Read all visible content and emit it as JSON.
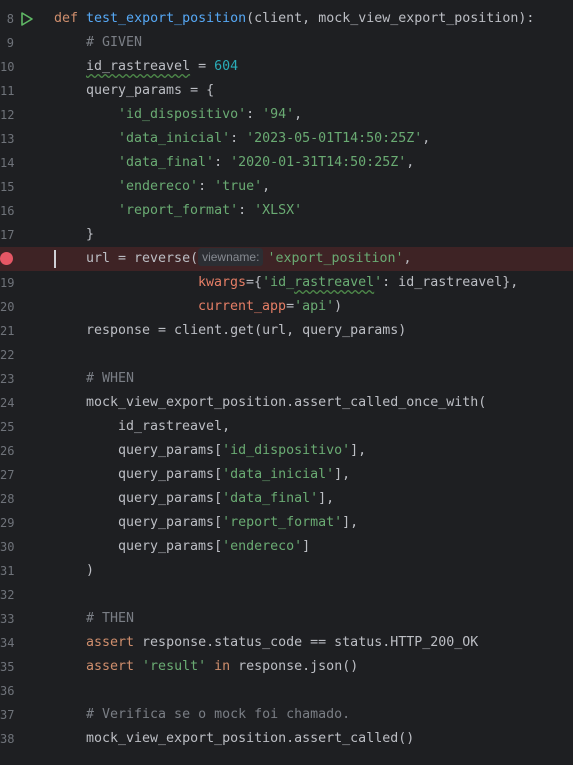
{
  "lines": [
    {
      "num": "8",
      "indent": 0,
      "tokens": [
        {
          "t": "def ",
          "c": "kw"
        },
        {
          "t": "test_export_position",
          "c": "fn"
        },
        {
          "t": "(client, mock_view_export_position):",
          "c": ""
        }
      ]
    },
    {
      "num": "9",
      "indent": 1,
      "tokens": [
        {
          "t": "# GIVEN",
          "c": "cm"
        }
      ]
    },
    {
      "num": "10",
      "indent": 1,
      "tokens": [
        {
          "t": "id_rastreavel",
          "c": "wavy"
        },
        {
          "t": " = ",
          "c": ""
        },
        {
          "t": "604",
          "c": "num"
        }
      ]
    },
    {
      "num": "11",
      "indent": 1,
      "tokens": [
        {
          "t": "query_params = {",
          "c": ""
        }
      ]
    },
    {
      "num": "12",
      "indent": 2,
      "tokens": [
        {
          "t": "'id_dispositivo'",
          "c": "str"
        },
        {
          "t": ": ",
          "c": ""
        },
        {
          "t": "'94'",
          "c": "str"
        },
        {
          "t": ",",
          "c": ""
        }
      ]
    },
    {
      "num": "13",
      "indent": 2,
      "tokens": [
        {
          "t": "'data_inicial'",
          "c": "str"
        },
        {
          "t": ": ",
          "c": ""
        },
        {
          "t": "'2023-05-01T14:50:25Z'",
          "c": "str"
        },
        {
          "t": ",",
          "c": ""
        }
      ]
    },
    {
      "num": "14",
      "indent": 2,
      "tokens": [
        {
          "t": "'data_final'",
          "c": "str"
        },
        {
          "t": ": ",
          "c": ""
        },
        {
          "t": "'2020-01-31T14:50:25Z'",
          "c": "str"
        },
        {
          "t": ",",
          "c": ""
        }
      ]
    },
    {
      "num": "15",
      "indent": 2,
      "tokens": [
        {
          "t": "'endereco'",
          "c": "str"
        },
        {
          "t": ": ",
          "c": ""
        },
        {
          "t": "'true'",
          "c": "str"
        },
        {
          "t": ",",
          "c": ""
        }
      ]
    },
    {
      "num": "16",
      "indent": 2,
      "tokens": [
        {
          "t": "'report_format'",
          "c": "str"
        },
        {
          "t": ": ",
          "c": ""
        },
        {
          "t": "'XLSX'",
          "c": "str"
        }
      ]
    },
    {
      "num": "17",
      "indent": 1,
      "tokens": [
        {
          "t": "}",
          "c": ""
        }
      ]
    },
    {
      "num": "",
      "indent": 1,
      "breakpoint": true,
      "tokens": [
        {
          "t": "url = reverse(",
          "c": ""
        },
        {
          "t": "viewname:",
          "c": "hint"
        },
        {
          "t": "'export_position'",
          "c": "str"
        },
        {
          "t": ",",
          "c": ""
        }
      ]
    },
    {
      "num": "19",
      "indent": 3,
      "tokens": [
        {
          "t": "kwargs",
          "c": "param"
        },
        {
          "t": "={",
          "c": ""
        },
        {
          "t": "'id_",
          "c": "str"
        },
        {
          "t": "rastreavel",
          "c": "str wavy"
        },
        {
          "t": "'",
          "c": "str"
        },
        {
          "t": ": id_rastreavel},",
          "c": ""
        }
      ]
    },
    {
      "num": "20",
      "indent": 3,
      "tokens": [
        {
          "t": "current_app",
          "c": "param"
        },
        {
          "t": "=",
          "c": ""
        },
        {
          "t": "'api'",
          "c": "str"
        },
        {
          "t": ")",
          "c": ""
        }
      ]
    },
    {
      "num": "21",
      "indent": 1,
      "tokens": [
        {
          "t": "response = client.get(url, query_params)",
          "c": ""
        }
      ]
    },
    {
      "num": "22",
      "indent": 1,
      "tokens": []
    },
    {
      "num": "23",
      "indent": 1,
      "tokens": [
        {
          "t": "# WHEN",
          "c": "cm"
        }
      ]
    },
    {
      "num": "24",
      "indent": 1,
      "tokens": [
        {
          "t": "mock_view_export_position.assert_called_once_with(",
          "c": ""
        }
      ]
    },
    {
      "num": "25",
      "indent": 2,
      "tokens": [
        {
          "t": "id_rastreavel,",
          "c": ""
        }
      ]
    },
    {
      "num": "26",
      "indent": 2,
      "tokens": [
        {
          "t": "query_params[",
          "c": ""
        },
        {
          "t": "'id_dispositivo'",
          "c": "str"
        },
        {
          "t": "],",
          "c": ""
        }
      ]
    },
    {
      "num": "27",
      "indent": 2,
      "tokens": [
        {
          "t": "query_params[",
          "c": ""
        },
        {
          "t": "'data_inicial'",
          "c": "str"
        },
        {
          "t": "],",
          "c": ""
        }
      ]
    },
    {
      "num": "28",
      "indent": 2,
      "tokens": [
        {
          "t": "query_params[",
          "c": ""
        },
        {
          "t": "'data_final'",
          "c": "str"
        },
        {
          "t": "],",
          "c": ""
        }
      ]
    },
    {
      "num": "29",
      "indent": 2,
      "tokens": [
        {
          "t": "query_params[",
          "c": ""
        },
        {
          "t": "'report_format'",
          "c": "str"
        },
        {
          "t": "],",
          "c": ""
        }
      ]
    },
    {
      "num": "30",
      "indent": 2,
      "tokens": [
        {
          "t": "query_params[",
          "c": ""
        },
        {
          "t": "'endereco'",
          "c": "str"
        },
        {
          "t": "]",
          "c": ""
        }
      ]
    },
    {
      "num": "31",
      "indent": 1,
      "tokens": [
        {
          "t": ")",
          "c": ""
        }
      ]
    },
    {
      "num": "32",
      "indent": 1,
      "tokens": []
    },
    {
      "num": "33",
      "indent": 1,
      "tokens": [
        {
          "t": "# THEN",
          "c": "cm"
        }
      ]
    },
    {
      "num": "34",
      "indent": 1,
      "tokens": [
        {
          "t": "assert ",
          "c": "kw"
        },
        {
          "t": "response.status_code == status.HTTP_200_OK",
          "c": ""
        }
      ]
    },
    {
      "num": "35",
      "indent": 1,
      "tokens": [
        {
          "t": "assert ",
          "c": "kw"
        },
        {
          "t": "'result'",
          "c": "str"
        },
        {
          "t": " in ",
          "c": "kw"
        },
        {
          "t": "response.json()",
          "c": ""
        }
      ]
    },
    {
      "num": "36",
      "indent": 1,
      "tokens": []
    },
    {
      "num": "37",
      "indent": 1,
      "tokens": [
        {
          "t": "# Verifica se o mock foi chamado.",
          "c": "cm"
        }
      ]
    },
    {
      "num": "38",
      "indent": 1,
      "tokens": [
        {
          "t": "mock_view_export_position.assert_called()",
          "c": ""
        }
      ]
    }
  ],
  "colors": {
    "background": "#1e1f22",
    "keyword": "#cf8e6d",
    "function": "#56a8f5",
    "string": "#6aab73",
    "number": "#2aacb8",
    "comment": "#7a7e85",
    "breakpoint": "#e55765",
    "run": "#5fb865"
  },
  "icons": {
    "run": "run-triangle-icon",
    "breakpoint": "breakpoint-icon"
  }
}
